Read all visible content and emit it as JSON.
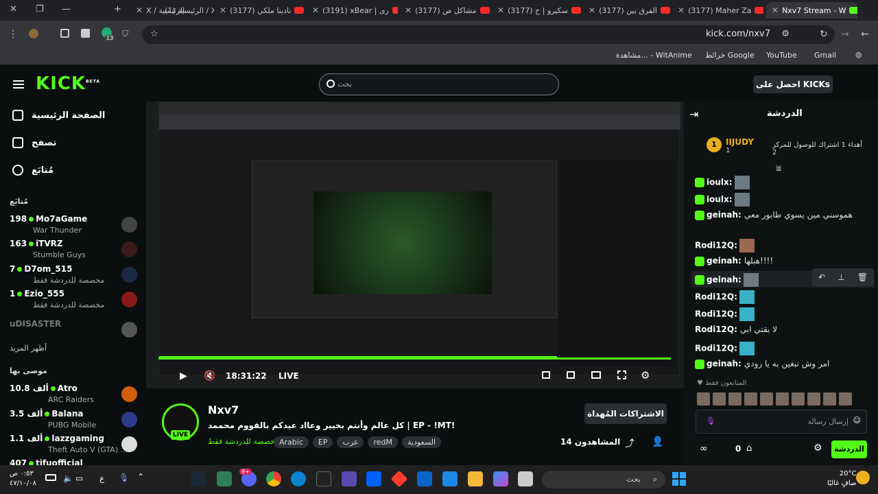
{
  "tabs": [
    {
      "label": "X / الرئيسية"
    },
    {
      "label": "(1) الرئيسية / X"
    },
    {
      "label": "(3177) نادينا ملكي"
    },
    {
      "label": "(3191) xBear | ری"
    },
    {
      "label": "(3177) مشاكل ص"
    },
    {
      "label": "(3177) سكيرو | ح"
    },
    {
      "label": "(3177) الفرق بين"
    },
    {
      "label": "(3177) Maher Za"
    },
    {
      "label": "Nxv7 Stream - W"
    }
  ],
  "address": {
    "url": "kick.com/nxv7",
    "tab_count": "13"
  },
  "bookmarks": [
    "Gmail",
    "YouTube",
    "خرائط Google",
    "مشاهدة... - WitAnime"
  ],
  "header": {
    "logo": "KICK",
    "logo_beta": "BETA",
    "search_placeholder": "بحث",
    "get_kicks": "احصل على KICKs"
  },
  "sidebar": {
    "nav": [
      {
        "label": "الصفحة الرئيسية"
      },
      {
        "label": "تصفح"
      },
      {
        "label": "مُتابَع"
      }
    ],
    "following_title": "مُتابَع",
    "following": [
      {
        "count": "198",
        "name": "Mo7aGame",
        "game": "War Thunder"
      },
      {
        "count": "163",
        "name": "iTVRZ",
        "game": "Stumble Guys"
      },
      {
        "count": "7",
        "name": "D7om_515",
        "game": "مخصصة للدردشة فقط"
      },
      {
        "count": "1",
        "name": "Ezio_555",
        "game": "مخصصة للدردشة فقط"
      },
      {
        "count": "",
        "name": "uDISASTER",
        "game": ""
      }
    ],
    "show_more": "أظهر المزيد",
    "recommended_title": "موصى بها",
    "recommended": [
      {
        "count": "10.8 ألف",
        "name": "Atro",
        "game": "ARC Raiders"
      },
      {
        "count": "3.5 ألف",
        "name": "Balana",
        "game": "PUBG Mobile"
      },
      {
        "count": "1.1 ألف",
        "name": "lazzgaming",
        "game": "Theft Auto V (GTA) ..."
      },
      {
        "count": "407",
        "name": "tifuofficial",
        "game": ""
      }
    ]
  },
  "player": {
    "time": "18:31:22",
    "live": "LIVE"
  },
  "channel": {
    "name": "Nxv7",
    "title": "كل عالم وأنتم بخيير وعااد عيدكم بالقووم محممد | EP - !MT!",
    "category": "مخصصة للدردشة فقط",
    "tags": [
      "Arabic",
      "EP",
      "عرب",
      "redM",
      "السعودية"
    ],
    "live": "LIVE",
    "subs_button": "الاشتراكات المُهداة",
    "viewers": "المشاهدون 14"
  },
  "chat": {
    "title": "الدردشة",
    "pinned_user": "IIJUDY",
    "pinned_count": "1",
    "pinned_text": "أهداء 1 اشتراك للوصول للمركز 2",
    "messages": [
      {
        "user": "ioulx:",
        "text": ""
      },
      {
        "user": "ioulx:",
        "text": ""
      },
      {
        "user": "geinah:",
        "text": "هموسني مين يسوي طابور معي"
      },
      {
        "user": "Rodi12Q:",
        "text": ""
      },
      {
        "user": "geinah:",
        "text": "هبلها!!!!"
      },
      {
        "user": "geinah:",
        "text": ""
      },
      {
        "user": "Rodi12Q:",
        "text": ""
      },
      {
        "user": "Rodi12Q:",
        "text": ""
      },
      {
        "user": "Rodi12Q:",
        "text": "لا بقتي ابي"
      },
      {
        "user": "Rodi12Q:",
        "text": ""
      },
      {
        "user": "geinah:",
        "text": "امر وش تبغين به يا رودي"
      }
    ],
    "followers_only": "المتابعون فقط",
    "input_placeholder": "إرسال رسالة",
    "send": "الدردشة",
    "points": "0"
  },
  "taskbar": {
    "time": "٠:٥٣ ص",
    "date": "٤٧/١٠/٠٨",
    "lang": "ع",
    "search": "بحث",
    "temp": "20°C",
    "weather": "صافٍ غالبًا",
    "discord_badge": "9+"
  },
  "colors": {
    "accent": "#53fc18",
    "bg": "#0b0e0f"
  }
}
